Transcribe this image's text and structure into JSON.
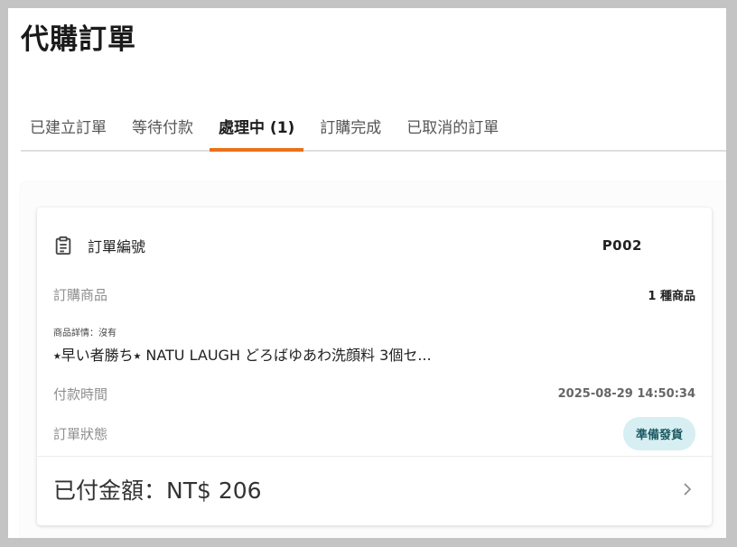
{
  "page": {
    "title": "代購訂單"
  },
  "tabs": [
    {
      "label": "已建立訂單",
      "active": false
    },
    {
      "label": "等待付款",
      "active": false
    },
    {
      "label": "處理中 (1)",
      "active": true
    },
    {
      "label": "訂購完成",
      "active": false
    },
    {
      "label": "已取消的訂單",
      "active": false
    }
  ],
  "order": {
    "number_label": "訂單編號",
    "number": "P002",
    "items_label": "訂購商品",
    "items_count": "1 種商品",
    "detail_label": "商品詳情：沒有",
    "product_name": "⭑早い者勝ち⭑ NATU LAUGH どろばゆあわ洗顔料 3個セ...",
    "paid_time_label": "付款時間",
    "paid_time": "2025-08-29 14:50:34",
    "status_label": "訂單狀態",
    "status": "準備發貨",
    "total": "已付金額：NT$ 206"
  },
  "icons": {
    "order": "clipboard-icon",
    "open": "chevron-right-icon"
  },
  "colors": {
    "accent": "#e8711a",
    "status_bg": "#d7eff2",
    "status_text": "#1c5a63"
  }
}
